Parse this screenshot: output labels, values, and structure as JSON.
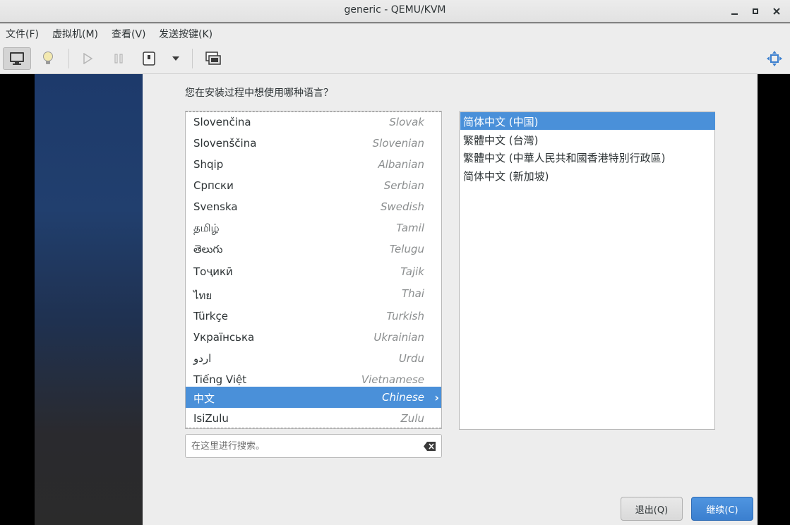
{
  "window": {
    "title": "generic - QEMU/KVM"
  },
  "menu": [
    "文件(F)",
    "虚拟机(M)",
    "查看(V)",
    "发送按键(K)"
  ],
  "installer": {
    "question": "您在安装过程中想使用哪种语言？",
    "languages": [
      {
        "native": "Slovenčina",
        "english": "Slovak"
      },
      {
        "native": "Slovenščina",
        "english": "Slovenian"
      },
      {
        "native": "Shqip",
        "english": "Albanian"
      },
      {
        "native": "Српски",
        "english": "Serbian"
      },
      {
        "native": "Svenska",
        "english": "Swedish"
      },
      {
        "native": "தமிழ்",
        "english": "Tamil"
      },
      {
        "native": "తెలుగు",
        "english": "Telugu"
      },
      {
        "native": "Тоҷикӣ",
        "english": "Tajik"
      },
      {
        "native": "ไทย",
        "english": "Thai"
      },
      {
        "native": "Türkçe",
        "english": "Turkish"
      },
      {
        "native": "Українська",
        "english": "Ukrainian"
      },
      {
        "native": "اردو",
        "english": "Urdu"
      },
      {
        "native": "Tiếng Việt",
        "english": "Vietnamese"
      },
      {
        "native": "中文",
        "english": "Chinese"
      },
      {
        "native": "IsiZulu",
        "english": "Zulu"
      }
    ],
    "selected_language": "Chinese",
    "locales": [
      "简体中文 (中国)",
      "繁體中文 (台灣)",
      "繁體中文 (中華人民共和國香港特別行政區)",
      "简体中文 (新加坡)"
    ],
    "selected_locale": "简体中文 (中国)",
    "search_placeholder": "在这里进行搜索。",
    "quit_label": "退出(Q)",
    "continue_label": "继续(C)"
  },
  "colors": {
    "selection": "#4a90d9",
    "primary_button": "#3b7fcf"
  }
}
